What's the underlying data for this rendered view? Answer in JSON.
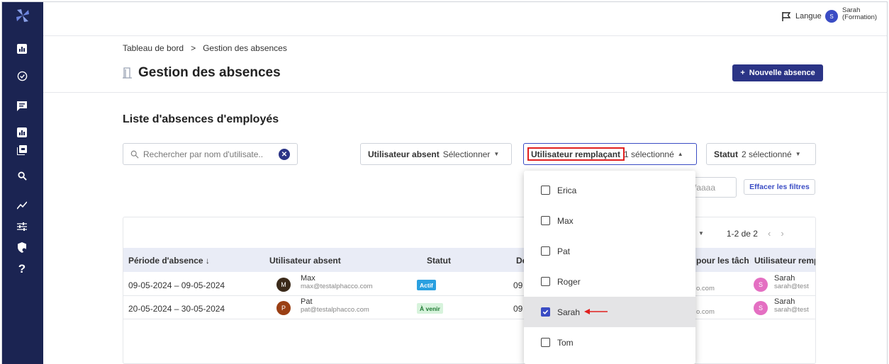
{
  "topbar": {
    "lang_label": "Langue",
    "user_initial": "S",
    "user_name": "Sarah",
    "user_role": "(Formation)"
  },
  "breadcrumb": {
    "home": "Tableau de bord",
    "sep": ">",
    "current": "Gestion des absences"
  },
  "page": {
    "title": "Gestion des absences",
    "new_button": "Nouvelle absence",
    "new_plus": "+"
  },
  "section": {
    "title": "Liste d'absences d'employés"
  },
  "search": {
    "placeholder": "Rechercher par nom d'utilisate..",
    "clear_glyph": "✕"
  },
  "filters": {
    "absent_label": "Utilisateur absent",
    "absent_value": "Sélectionner",
    "replacement_label": "Utilisateur remplaçant",
    "replacement_value": "1 sélectionné",
    "status_label": "Statut",
    "status_value": "2 sélectionné",
    "date_placeholder": "/aaaa",
    "clear_filters": "Effacer les filtres"
  },
  "pager": {
    "range": "1-2 de 2",
    "prev": "‹",
    "next": "›"
  },
  "table": {
    "headers": [
      "Période d'absence ↓",
      "Utilisateur absent",
      "Statut",
      "De",
      "pour les tâch",
      "Utilisateur remp"
    ],
    "rows": [
      {
        "period": "09-05-2024 – 09-05-2024",
        "absent_initial": "M",
        "absent_name": "Max",
        "absent_email": "max@testalphacco.com",
        "status": "Actif",
        "from": "09",
        "tasks": "o.com",
        "repl_initial": "S",
        "repl_name": "Sarah",
        "repl_email": "sarah@test"
      },
      {
        "period": "20-05-2024 – 30-05-2024",
        "absent_initial": "P",
        "absent_name": "Pat",
        "absent_email": "pat@testalphacco.com",
        "status": "À venir",
        "from": "09",
        "tasks": "o.com",
        "repl_initial": "S",
        "repl_name": "Sarah",
        "repl_email": "sarah@test"
      }
    ]
  },
  "dropdown": {
    "options": [
      {
        "label": "Erica",
        "checked": false
      },
      {
        "label": "Max",
        "checked": false
      },
      {
        "label": "Pat",
        "checked": false
      },
      {
        "label": "Roger",
        "checked": false
      },
      {
        "label": "Sarah",
        "checked": true
      },
      {
        "label": "Tom",
        "checked": false
      }
    ]
  },
  "colors": {
    "sidebar": "#1b2452",
    "primary": "#2b3486",
    "accent": "#3a4cc4",
    "highlight": "#e0201f",
    "active_badge": "#2aa0e0",
    "upcoming_badge": "#d7f3dc"
  },
  "icons": [
    "logo-icon",
    "dashboard-icon",
    "check-circle-icon",
    "chat-icon",
    "chart-icon",
    "stack-icon",
    "search-icon",
    "trend-icon",
    "sliders-icon",
    "shield-icon",
    "help-icon",
    "flag-icon",
    "door-icon"
  ]
}
